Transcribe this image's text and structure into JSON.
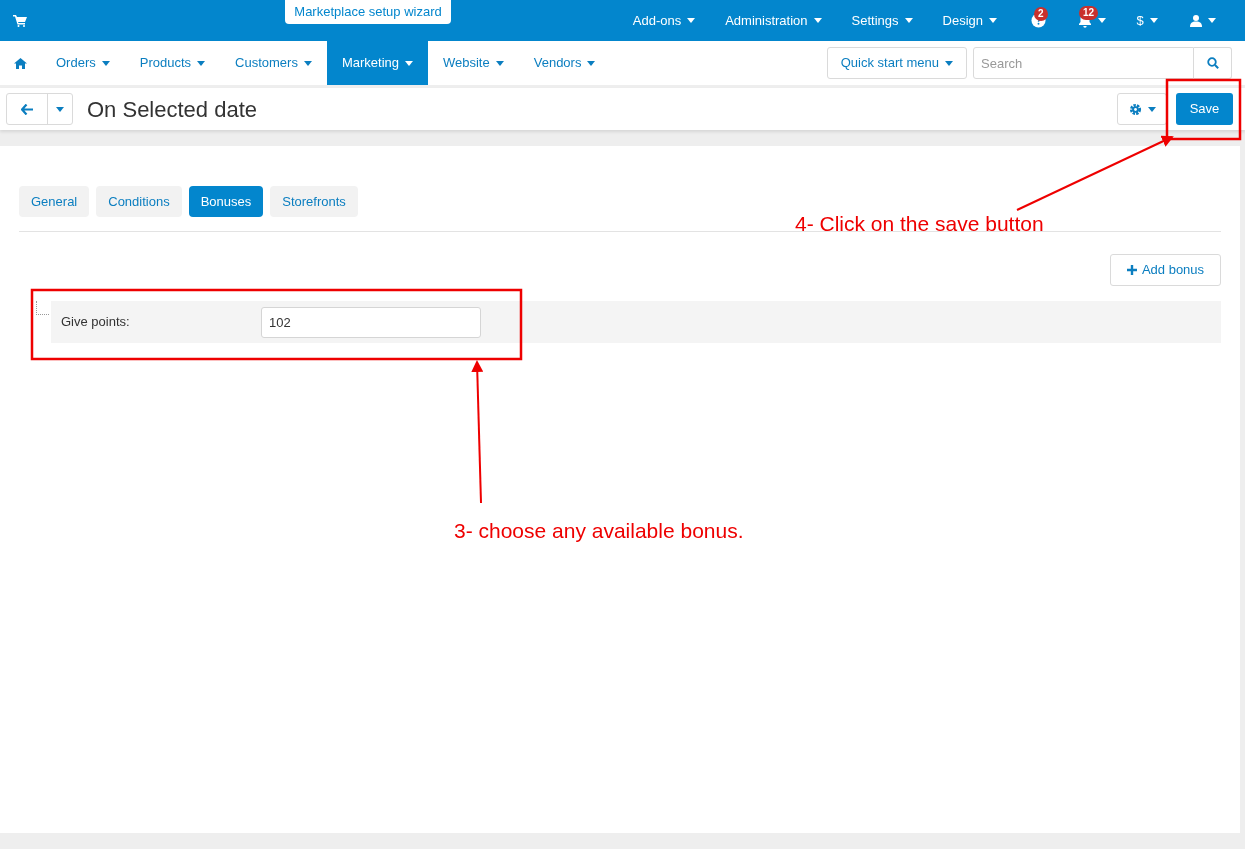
{
  "top_bar": {
    "wizard_tab": "Marketplace setup wizard",
    "menus": [
      {
        "label": "Add-ons"
      },
      {
        "label": "Administration"
      },
      {
        "label": "Settings"
      },
      {
        "label": "Design"
      }
    ],
    "help_badge": "2",
    "notifications_badge": "12",
    "currency": "$"
  },
  "nav": {
    "items": [
      {
        "label": "Orders",
        "selected": false
      },
      {
        "label": "Products",
        "selected": false
      },
      {
        "label": "Customers",
        "selected": false
      },
      {
        "label": "Marketing",
        "selected": true
      },
      {
        "label": "Website",
        "selected": false
      },
      {
        "label": "Vendors",
        "selected": false
      }
    ],
    "quick_start": "Quick start menu",
    "search": {
      "placeholder": "Search"
    }
  },
  "header": {
    "title": "On Selected date",
    "save": "Save"
  },
  "tabs": [
    {
      "label": "General",
      "selected": false
    },
    {
      "label": "Conditions",
      "selected": false
    },
    {
      "label": "Bonuses",
      "selected": true
    },
    {
      "label": "Storefronts",
      "selected": false
    }
  ],
  "add_bonus": "Add bonus",
  "bonus": {
    "label": "Give points:",
    "value": "102"
  },
  "annotations": [
    {
      "text": "4- Click on the save button"
    },
    {
      "text": "3- choose any available bonus."
    }
  ]
}
